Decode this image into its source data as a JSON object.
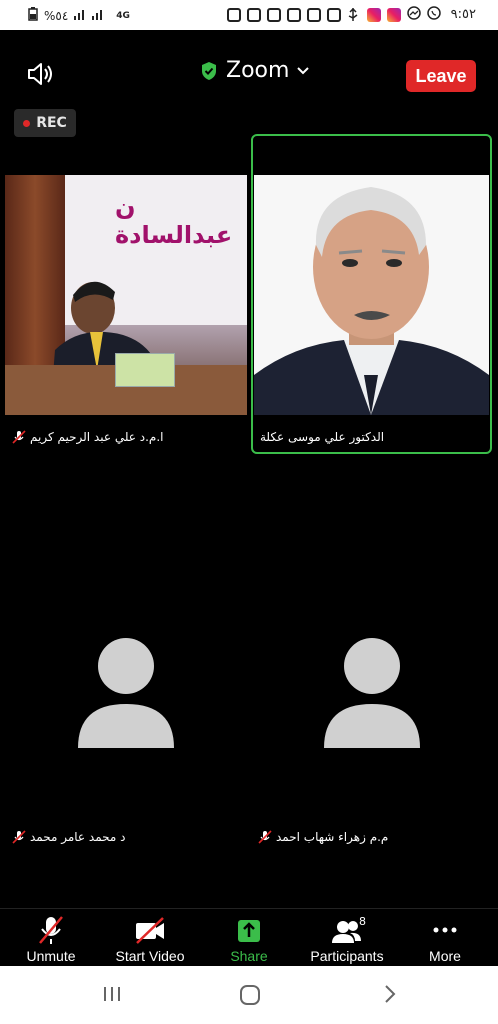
{
  "status_bar": {
    "time": "٩:٥٢",
    "battery": "%٥٤",
    "network": "4G"
  },
  "meeting": {
    "title": "Zoom",
    "leave_label": "Leave",
    "rec_label": "REC"
  },
  "tiles": [
    {
      "name": "ا.م.د علي عبد الرحيم كريم"
    },
    {
      "name": "الدكتور علي موسى عكلة"
    },
    {
      "name": "د محمد عامر محمد"
    },
    {
      "name": "م.م زهراء شهاب احمد"
    }
  ],
  "photo1_banner": "ن عبدالسادة",
  "toolbar": {
    "unmute": "Unmute",
    "start_video": "Start Video",
    "share": "Share",
    "participants": "Participants",
    "participants_count": "8",
    "more": "More"
  },
  "colors": {
    "leave": "#e02828",
    "active_border": "#3bbd4a",
    "share": "#3bbd4a"
  }
}
